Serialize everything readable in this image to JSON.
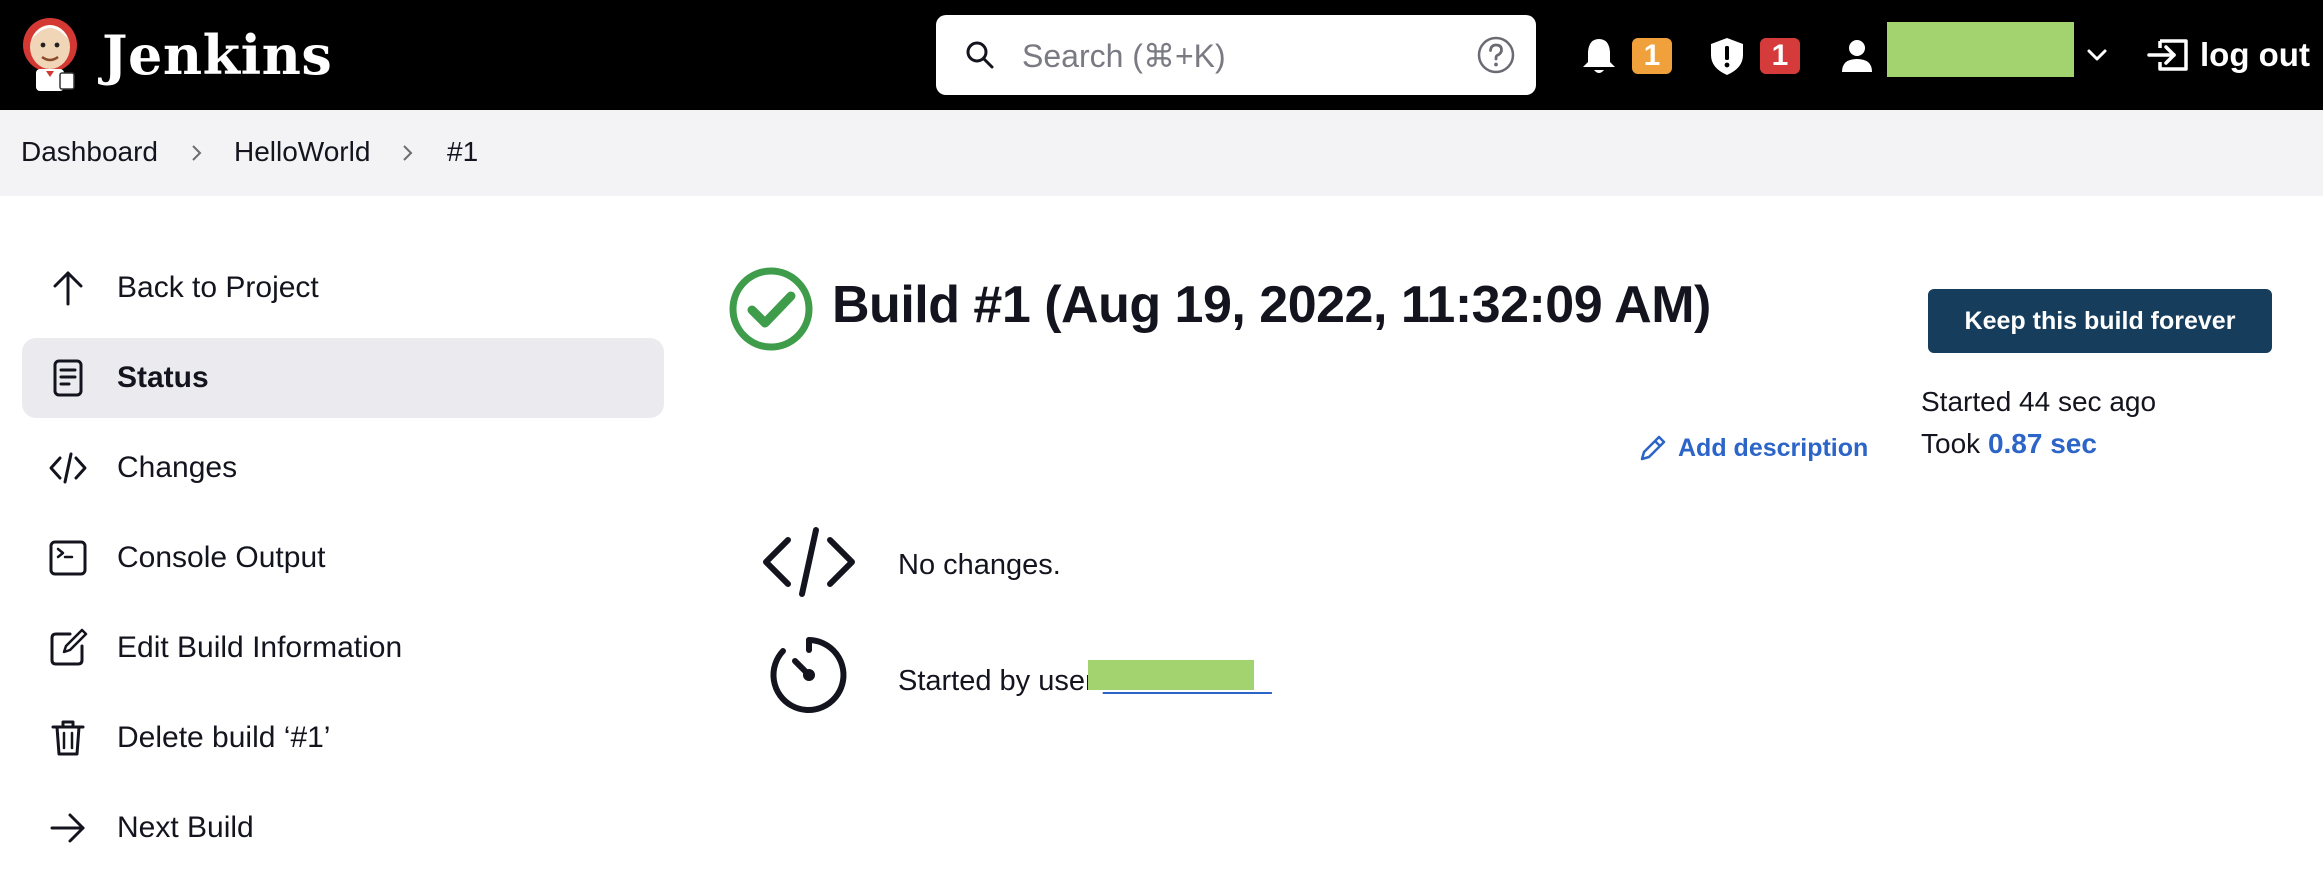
{
  "header": {
    "app_name": "Jenkins",
    "search": {
      "placeholder": "Search (⌘+K)"
    },
    "notifications": {
      "icon": "bell-icon",
      "count": "1",
      "badge_color": "#f0a13b"
    },
    "security": {
      "icon": "shield-alert-icon",
      "count": "1",
      "badge_color": "#d63b3b"
    },
    "user": {
      "name_redacted": true,
      "redaction_color": "#a3d36e"
    },
    "logout_label": "log out"
  },
  "breadcrumb": [
    "Dashboard",
    "HelloWorld",
    "#1"
  ],
  "sidebar": {
    "items": [
      {
        "label": "Back to Project",
        "icon": "arrow-up-icon",
        "active": false
      },
      {
        "label": "Status",
        "icon": "document-icon",
        "active": true
      },
      {
        "label": "Changes",
        "icon": "code-icon",
        "active": false
      },
      {
        "label": "Console Output",
        "icon": "terminal-icon",
        "active": false
      },
      {
        "label": "Edit Build Information",
        "icon": "edit-icon",
        "active": false
      },
      {
        "label": "Delete build ‘#1’",
        "icon": "trash-icon",
        "active": false
      },
      {
        "label": "Next Build",
        "icon": "arrow-right-icon",
        "active": false
      }
    ]
  },
  "build": {
    "title": "Build #1 (Aug 19, 2022, 11:32:09 AM)",
    "status": "success",
    "status_color": "#3f9c4a",
    "keep_button_label": "Keep this build forever",
    "started": "Started 44 sec ago",
    "took_prefix": "Took ",
    "took_value": "0.87 sec",
    "add_description_label": "Add description",
    "changes_text": "No changes.",
    "started_by_prefix": "Started by user "
  },
  "colors": {
    "header_bg": "#000000",
    "breadcrumb_bg": "#f3f3f5",
    "link": "#2c64c7",
    "button_bg": "#163d5c"
  }
}
